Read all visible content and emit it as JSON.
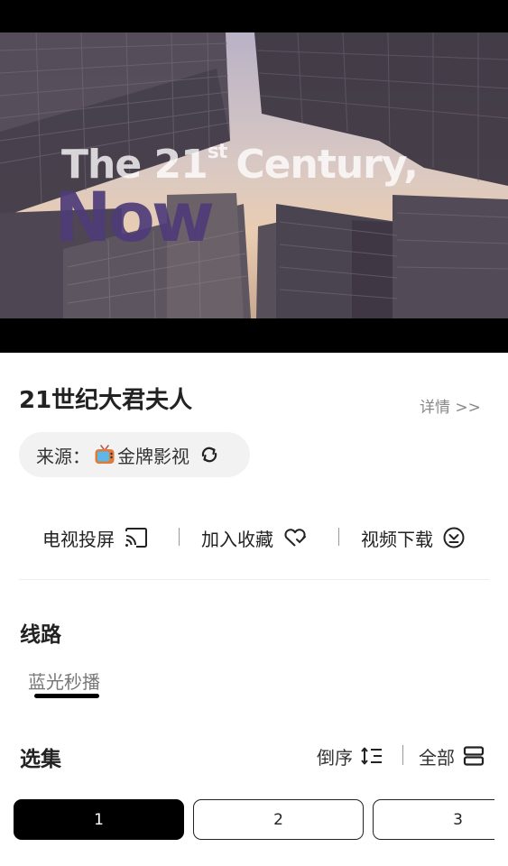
{
  "player": {
    "overlay_line1_prefix": "The 21",
    "overlay_line1_sup": "st",
    "overlay_line1_suffix": "Century,",
    "overlay_line2": "Now"
  },
  "title": "21世纪大君夫人",
  "detail_link": "详情 >>",
  "source": {
    "label": "来源：",
    "name": "金牌影视",
    "icon": "tv-icon",
    "action_icon": "refresh-icon"
  },
  "actions": [
    {
      "label": "电视投屏",
      "icon": "cast-icon"
    },
    {
      "label": "加入收藏",
      "icon": "heart-icon"
    },
    {
      "label": "视频下载",
      "icon": "download-icon"
    }
  ],
  "route": {
    "title": "线路",
    "tabs": [
      {
        "label": "蓝光秒播",
        "selected": true
      }
    ]
  },
  "episodes": {
    "title": "选集",
    "sort_label": "倒序",
    "all_label": "全部",
    "items": [
      {
        "label": "1",
        "active": true
      },
      {
        "label": "2",
        "active": false
      },
      {
        "label": "3",
        "active": false
      }
    ]
  },
  "colors": {
    "accent": "#000000",
    "chip_bg": "#f2f2f2",
    "muted_text": "#888888"
  }
}
